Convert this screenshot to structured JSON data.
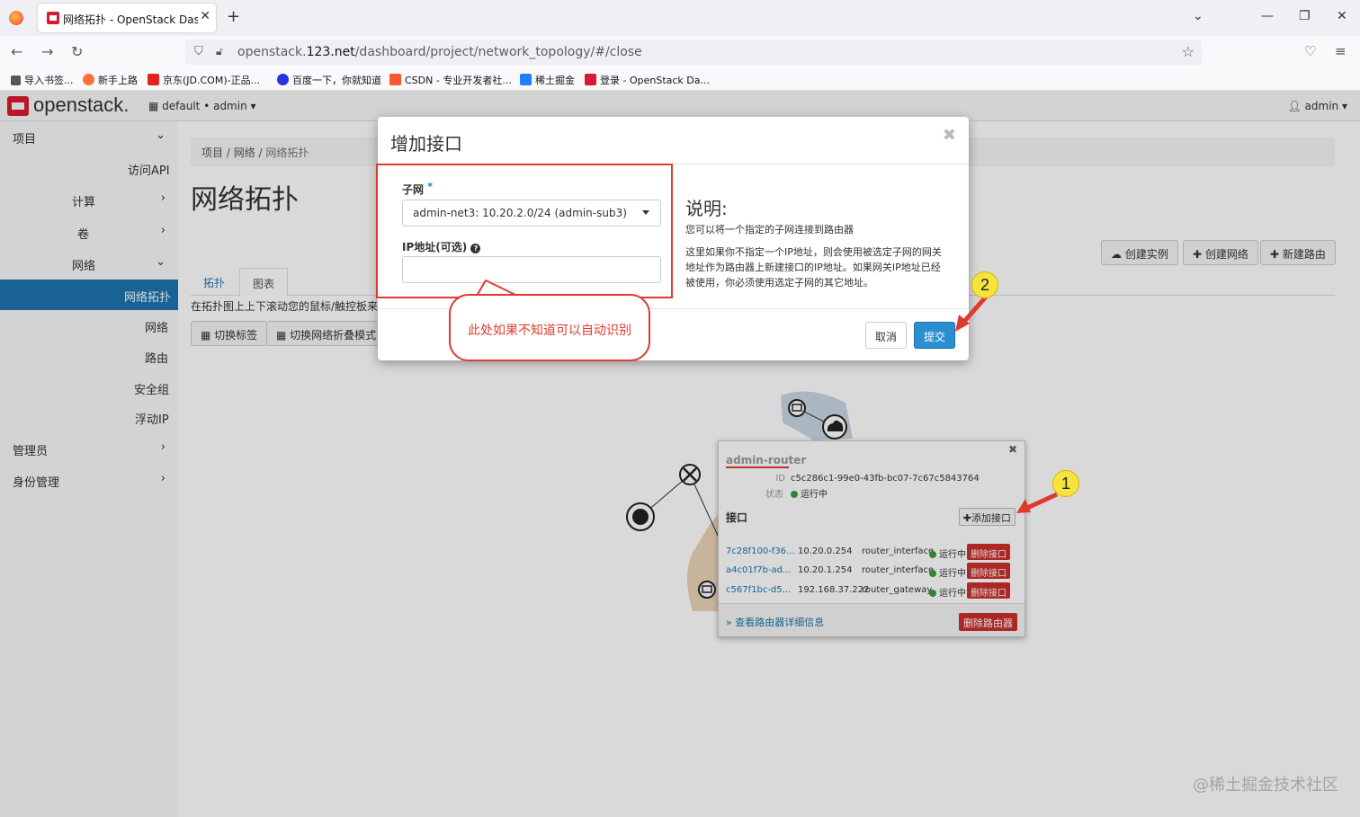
{
  "browser": {
    "tab_title": "网络拓扑 - OpenStack Dashboard",
    "url_prefix": "openstack.",
    "url_host": "123.net",
    "url_path": "/dashboard/project/network_topology/#/close",
    "bookmarks": [
      {
        "label": "导入书签...",
        "icon": "import-icon",
        "color": "#555555"
      },
      {
        "label": "新手上路",
        "icon": "firefox-icon",
        "color": "#ff7139"
      },
      {
        "label": "京东(JD.COM)-正品...",
        "icon": "jd-icon",
        "color": "#e1251b"
      },
      {
        "label": "百度一下，你就知道",
        "icon": "baidu-icon",
        "color": "#2932e1"
      },
      {
        "label": "CSDN - 专业开发者社...",
        "icon": "csdn-icon",
        "color": "#fc5531"
      },
      {
        "label": "稀土掘金",
        "icon": "juejin-icon",
        "color": "#1e80ff"
      },
      {
        "label": "登录 - OpenStack Da...",
        "icon": "openstack-icon",
        "color": "#da1a32"
      }
    ]
  },
  "header": {
    "logo": "openstack.",
    "project_select": "default • admin",
    "user": "admin"
  },
  "sidebar": {
    "items": [
      {
        "label": "项目",
        "chevron": "⌄"
      },
      {
        "label": "访问API",
        "chevron": ""
      },
      {
        "label": "计算",
        "chevron": "›"
      },
      {
        "label": "卷",
        "chevron": "›"
      },
      {
        "label": "网络",
        "chevron": "⌄"
      },
      {
        "label": "网络拓扑",
        "chevron": ""
      },
      {
        "label": "网络",
        "chevron": ""
      },
      {
        "label": "路由",
        "chevron": ""
      },
      {
        "label": "安全组",
        "chevron": ""
      },
      {
        "label": "浮动IP",
        "chevron": ""
      },
      {
        "label": "管理员",
        "chevron": "›"
      },
      {
        "label": "身份管理",
        "chevron": "›"
      }
    ]
  },
  "main": {
    "breadcrumb": [
      "项目",
      "网络",
      "网络拓扑"
    ],
    "title": "网络拓扑",
    "actions": [
      "创建实例",
      "创建网络",
      "新建路由"
    ],
    "tabs": [
      "拓扑",
      "图表"
    ],
    "hint": "在拓扑图上上下滚动您的鼠标/触控板来缩",
    "toggle_labels": "切换标签",
    "toggle_collapse": "切换网络折叠模式"
  },
  "router_popup": {
    "name": "admin-router",
    "id_label": "ID",
    "id": "c5c286c1-99e0-43fb-bc07-7c67c5843764",
    "status_label": "状态",
    "status": "运行中",
    "interfaces_title": "接口",
    "add_interface": "添加接口",
    "interfaces": [
      {
        "id": "7c28f100-f36...",
        "ip": "10.20.0.254",
        "type": "router_interface",
        "status": "运行中",
        "action": "删除接口"
      },
      {
        "id": "a4c01f7b-ad...",
        "ip": "10.20.1.254",
        "type": "router_interface",
        "status": "运行中",
        "action": "删除接口"
      },
      {
        "id": "c567f1bc-d5...",
        "ip": "192.168.37.222",
        "type": "router_gateway",
        "status": "运行中",
        "action": "删除接口"
      }
    ],
    "detail_link": "» 查看路由器详细信息",
    "delete_router": "删除路由器"
  },
  "modal": {
    "title": "增加接口",
    "subnet_label": "子网",
    "subnet_required": "*",
    "subnet_value": "admin-net3: 10.20.2.0/24 (admin-sub3)",
    "ip_label": "IP地址(可选)",
    "ip_value": "",
    "desc_title": "说明:",
    "desc_1": "您可以将一个指定的子网连接到路由器",
    "desc_2": "这里如果你不指定一个IP地址，则会使用被选定子网的网关地址作为路由器上新建接口的IP地址。如果网关IP地址已经被使用，你必须使用选定子网的其它地址。",
    "cancel": "取消",
    "submit": "提交"
  },
  "annotations": {
    "callout": "此处如果不知道可以自动识别",
    "badge_1": "1",
    "badge_2": "2",
    "color": "#e03a2f"
  },
  "watermark": "@稀土掘金技术社区"
}
